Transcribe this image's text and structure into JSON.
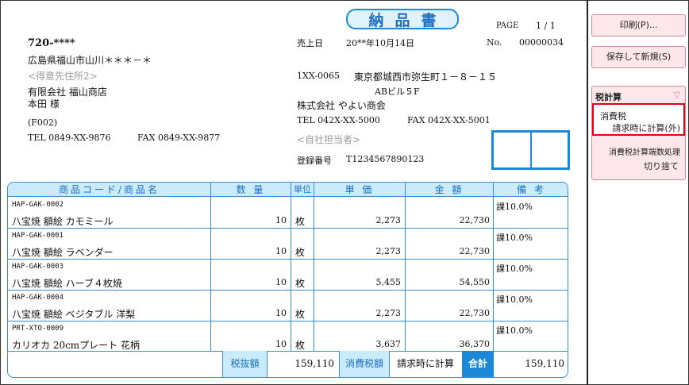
{
  "doc": {
    "title": "納品書",
    "page_label": "PAGE",
    "page_value": "1 / 1",
    "no_label": "No.",
    "no_value": "00000034",
    "sales_date_label": "売上日",
    "sales_date_value": "20**年10月14日"
  },
  "customer": {
    "zip": "720-****",
    "address1": "広島県福山市山川＊＊＊－＊",
    "address2": "<得意先住所2>",
    "company": "有限会社 福山商店",
    "person": "本田 様",
    "code": "(F002)",
    "tel": "TEL 0849-XX-9876",
    "fax": "FAX 0849-XX-9877"
  },
  "sender": {
    "zip": "1XX-0065",
    "address1": "東京都城西市弥生町１－８－１５",
    "address2": "ABビル５F",
    "company": "株式会社 やよい商会",
    "tel": "TEL 042X-XX-5000",
    "fax": "FAX 042X-XX-5001",
    "person": "<自社担当者>",
    "reg_label": "登録番号",
    "reg_no": "T1234567890123"
  },
  "table": {
    "headers": {
      "item": "商品コード/商品名",
      "qty": "数 量",
      "unit": "単位",
      "price": "単 価",
      "amount": "金 額",
      "note": "備 考"
    },
    "rows": [
      {
        "code": "HAP-GAK-0002",
        "name": "八宝焼 額絵 カモミール",
        "qty": "10",
        "unit": "枚",
        "price": "2,273",
        "amount": "22,730",
        "tax": "課10.0%"
      },
      {
        "code": "HAP-GAK-0001",
        "name": "八宝焼 額絵 ラベンダー",
        "qty": "10",
        "unit": "枚",
        "price": "2,273",
        "amount": "22,730",
        "tax": "課10.0%"
      },
      {
        "code": "HAP-GAK-0003",
        "name": "八宝焼 額絵 ハーブ４枚焼",
        "qty": "10",
        "unit": "枚",
        "price": "5,455",
        "amount": "54,550",
        "tax": "課10.0%"
      },
      {
        "code": "HAP-GAK-0004",
        "name": "八宝焼 額絵 ベジタブル 洋梨",
        "qty": "10",
        "unit": "枚",
        "price": "2,273",
        "amount": "22,730",
        "tax": "課10.0%"
      },
      {
        "code": "PRT-XTO-0009",
        "name": "カリオカ 20cmプレート 花柄",
        "qty": "10",
        "unit": "枚",
        "price": "3,637",
        "amount": "36,370",
        "tax": "課10.0%"
      }
    ],
    "footer": {
      "subtotal_label": "税抜額",
      "subtotal_value": "159,110",
      "tax_label": "消費税額",
      "tax_value": "請求時に計算",
      "total_label": "合計",
      "total_value": "159,110"
    }
  },
  "sidebar": {
    "print_label": "印刷(P)...",
    "save_new_label": "保存して新規(S)",
    "tax_calc_title": "税計算",
    "consumption_tax_title": "消費税",
    "consumption_tax_value": "請求時に計算(外)",
    "rounding_title": "消費税計算端数処理",
    "rounding_value": "切り捨て"
  }
}
